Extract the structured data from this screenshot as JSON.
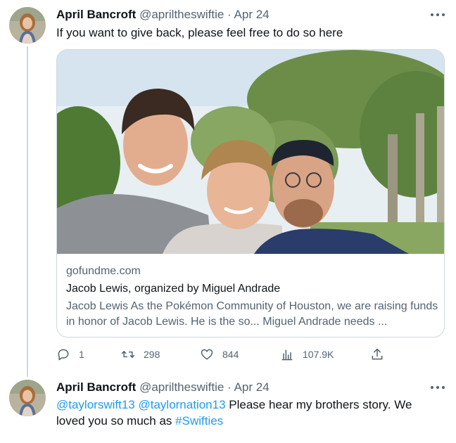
{
  "tweets": [
    {
      "author": {
        "name": "April Bancroft",
        "handle": "@apriltheswiftie",
        "separator": "·",
        "date": "Apr 24"
      },
      "text": "If you want to give back, please feel free to do so here",
      "card": {
        "domain": "gofundme.com",
        "title": "Jacob Lewis, organized by Miguel Andrade",
        "description": "Jacob Lewis As the Pokémon Community of Houston, we are raising funds in honor of Jacob Lewis. He is the so... Miguel Andrade needs ..."
      },
      "metrics": {
        "replies": "1",
        "reposts": "298",
        "likes": "844",
        "views": "107.9K"
      }
    },
    {
      "author": {
        "name": "April Bancroft",
        "handle": "@apriltheswiftie",
        "separator": "·",
        "date": "Apr 24"
      },
      "text_parts": {
        "mention1": "@taylorswift13",
        "mention2": "@taylornation13",
        "body": "Please hear my brothers story. We loved you so much as",
        "hashtag": "#Swifties"
      }
    }
  ],
  "icons": {
    "more": "more-horizontal-icon",
    "reply": "reply-icon",
    "repost": "repost-icon",
    "like": "heart-icon",
    "views": "views-icon",
    "share": "share-icon"
  },
  "colors": {
    "link": "#1d9bf0",
    "secondary_text": "#536471",
    "border": "#cfd9de"
  }
}
